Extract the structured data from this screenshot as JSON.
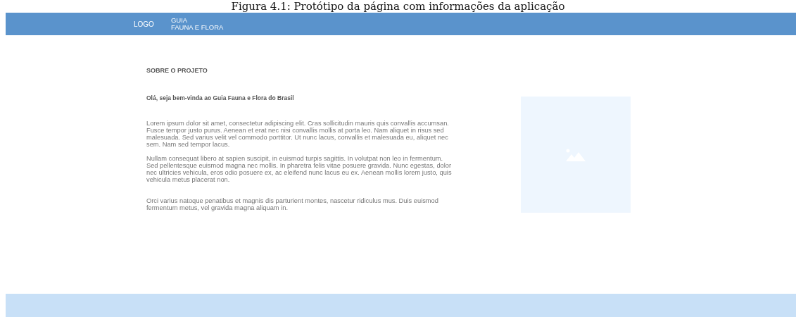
{
  "caption": "Figura 4.1: Protótipo da página com informações da aplicação",
  "header": {
    "logo": "LOGO",
    "brand_lines": [
      "GUIA",
      "FAUNA E FLORA"
    ]
  },
  "content": {
    "section_title": "SOBRE O PROJETO",
    "greeting": "Olá, seja bem-vinda ao Guia Fauna e Flora do Brasil",
    "paragraphs": [
      "Lorem ipsum dolor sit amet, consectetur adipiscing elit. Cras sollicitudin mauris quis convallis accumsan. Fusce tempor justo purus. Aenean et erat nec nisi convallis mollis at porta leo. Nam aliquet in risus sed malesuada. Sed varius velit vel commodo porttitor. Ut nunc lacus, convallis et malesuada eu, aliquet nec sem. Nam sed tempor lacus.",
      "Nullam consequat libero at sapien suscipit, in euismod turpis sagittis. In volutpat non leo in fermentum. Sed pellentesque euismod magna nec mollis. In pharetra felis vitae posuere gravida. Nunc egestas, dolor nec ultricies vehicula, eros odio posuere ex, ac eleifend nunc lacus eu ex. Aenean mollis lorem justo, quis vehicula metus placerat non.",
      "Orci varius natoque penatibus et magnis dis parturient montes, nascetur ridiculus mus. Duis euismod fermentum metus, vel gravida magna aliquam in."
    ],
    "image": {
      "kind": "placeholder"
    }
  }
}
